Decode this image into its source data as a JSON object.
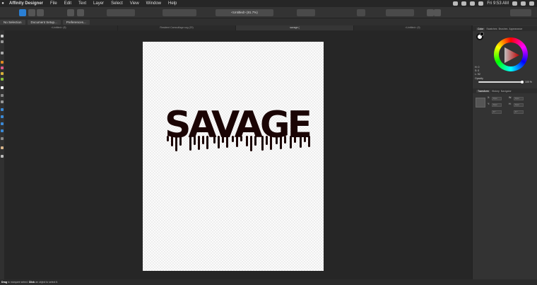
{
  "menubar": {
    "app_name": "Affinity Designer",
    "items": [
      "File",
      "Edit",
      "Text",
      "Layer",
      "Select",
      "View",
      "Window",
      "Help"
    ],
    "clock": "Fri 9:53 AM"
  },
  "toolbar": {
    "zoom_label": "<Untitled> (81.7%)"
  },
  "context_toolbar": {
    "buttons": [
      "No Selection",
      "Document Setup...",
      "Preferences..."
    ]
  },
  "document_tabs": [
    "<Untitled> (8)",
    "Resident Camouflage.svg (20)",
    "savage (",
    "<Untitled> (9)"
  ],
  "artwork": {
    "text": "SAVAGE",
    "text_color": "#1b0505"
  },
  "color_panel": {
    "tabs": [
      "Color",
      "Swatches",
      "Brushes",
      "Appearance"
    ],
    "hsl": [
      "H: 0",
      "S: 0",
      "L: 92"
    ],
    "opacity_label": "Opacity",
    "opacity_value": "100 %",
    "opacity_level": 1.0
  },
  "transform_panel": {
    "tabs": [
      "Transform",
      "History",
      "Navigator"
    ],
    "x": "0 px",
    "y": "0 px",
    "w": "0 px",
    "h": "0 px",
    "r": "0 °",
    "s": "0 °",
    "labels": [
      "X:",
      "Y:",
      "W:",
      "H:"
    ]
  },
  "statusbar": {
    "drag_word": "Drag",
    "drag_text": " to marquee select. ",
    "click_word": "Click",
    "click_text": " an object to select it."
  }
}
